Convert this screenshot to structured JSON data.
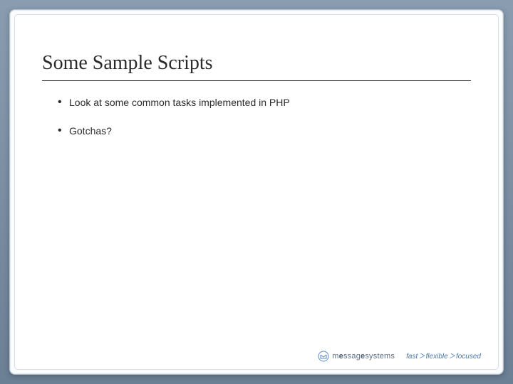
{
  "slide": {
    "title": "Some Sample Scripts",
    "bullets": [
      "Look at some common tasks implemented in PHP",
      "Gotchas?"
    ]
  },
  "footer": {
    "brand_prefix": "m",
    "brand_bold": "e",
    "brand_suffix": "ssag",
    "brand_bold2": "e",
    "brand_end": "systems",
    "tagline_parts": [
      "fast",
      "flexible",
      "focused"
    ]
  }
}
